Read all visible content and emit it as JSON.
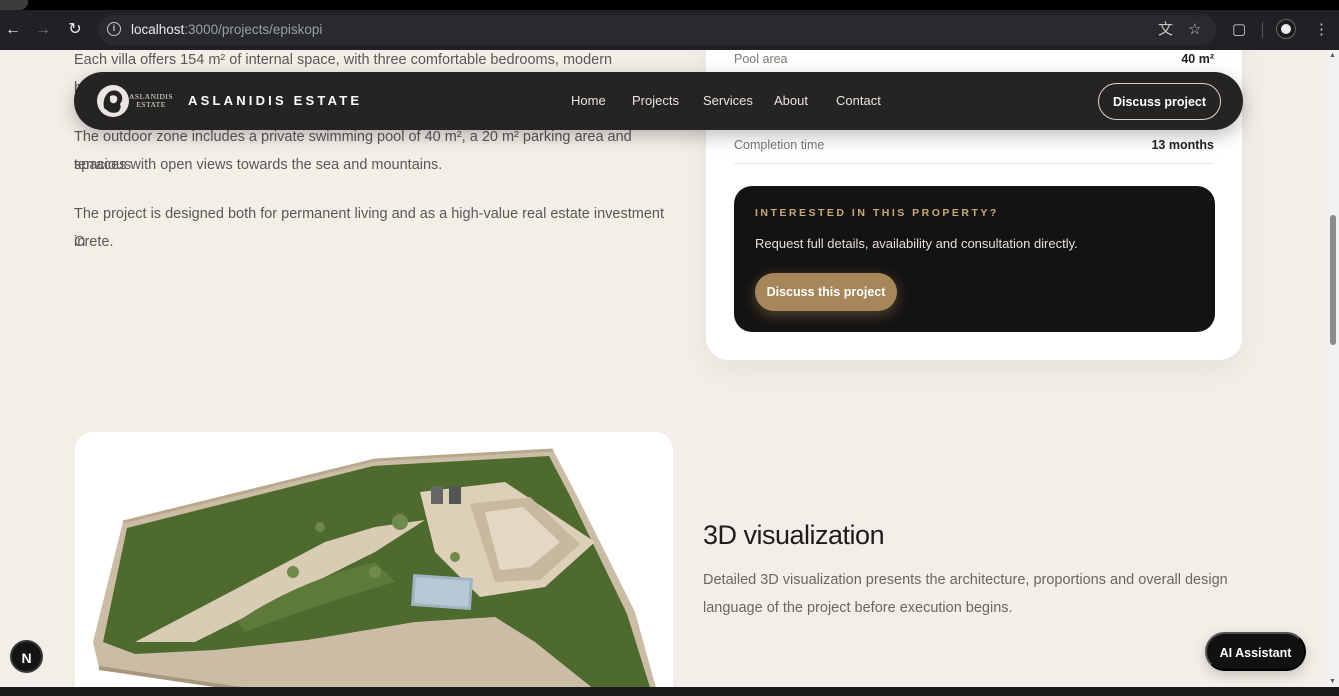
{
  "browser": {
    "url_host": "localhost",
    "url_path": ":3000/projects/episkopi",
    "back_icon": "arrow-left",
    "forward_icon": "arrow-right",
    "reload_icon": "reload"
  },
  "header": {
    "logo_line1": "ASLANIDIS",
    "logo_line2": "ESTATE",
    "brand": "ASLANIDIS ESTATE",
    "nav": [
      "Home",
      "Projects",
      "Services",
      "About",
      "Contact"
    ],
    "cta": "Discuss project"
  },
  "description": {
    "p1": "Each villa offers 154 m² of internal space, with three comfortable bedrooms, modern bathrooms",
    "p2_line1": "The outdoor zone includes a private swimming pool of 40 m², a 20 m² parking area and spacious",
    "p2_line2": "terraces with open views towards the sea and mountains.",
    "p3_line1": "The project is designed both for permanent living and as a high-value real estate investment in",
    "p3_line2": "Crete."
  },
  "specs": [
    {
      "label": "Pool area",
      "value": "40 m²"
    },
    {
      "label": "Completion time",
      "value": "13 months"
    }
  ],
  "cta_card": {
    "eyebrow": "INTERESTED IN THIS PROPERTY?",
    "text": "Request full details, availability and consultation directly.",
    "button": "Discuss this project"
  },
  "visualization": {
    "title": "3D visualization",
    "text": "Detailed 3D visualization presents the architecture, proportions and overall design language of the project before execution begins."
  },
  "floating": {
    "next_badge": "N",
    "ai_button": "AI Assistant"
  }
}
